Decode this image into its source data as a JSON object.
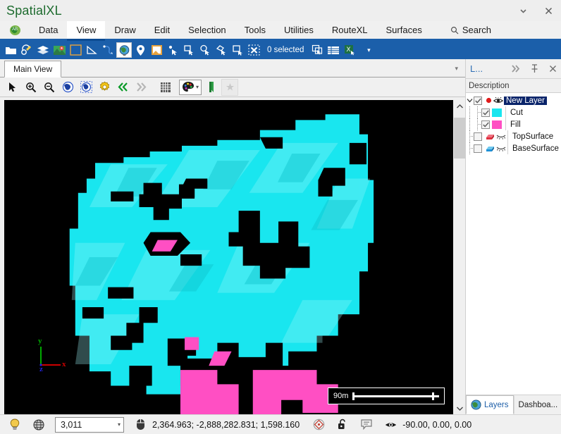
{
  "window": {
    "title": "SpatialXL",
    "minimize_icon": "chevron-down-icon",
    "close_icon": "close-icon"
  },
  "menubar": {
    "logo_icon": "globe-ab-icon",
    "items": [
      {
        "label": "Data",
        "active": false
      },
      {
        "label": "View",
        "active": true
      },
      {
        "label": "Draw",
        "active": false
      },
      {
        "label": "Edit",
        "active": false
      },
      {
        "label": "Selection",
        "active": false
      },
      {
        "label": "Tools",
        "active": false
      },
      {
        "label": "Utilities",
        "active": false
      },
      {
        "label": "RouteXL",
        "active": false
      },
      {
        "label": "Surfaces",
        "active": false
      }
    ],
    "search": {
      "label": "Search",
      "icon": "search-icon"
    }
  },
  "ribbon": {
    "selection_status": "0 selected",
    "buttons": [
      {
        "name": "open-folder-icon"
      },
      {
        "name": "project-settings-icon"
      },
      {
        "name": "layers-stack-icon"
      },
      {
        "name": "map-image-icon"
      },
      {
        "name": "boundary-icon"
      },
      {
        "name": "measure-angle-icon"
      },
      {
        "name": "polyline-tool-icon"
      },
      {
        "name": "globe-icon"
      },
      {
        "name": "place-marker-icon"
      },
      {
        "name": "note-icon"
      },
      {
        "name": "select-point-icon"
      },
      {
        "name": "select-rectangle-icon"
      },
      {
        "name": "select-circle-icon"
      },
      {
        "name": "select-polygon-icon"
      },
      {
        "name": "select-inside-icon"
      },
      {
        "name": "clear-selection-icon"
      },
      {
        "name": "duplicate-selection-icon"
      },
      {
        "name": "attribute-table-icon"
      },
      {
        "name": "export-excel-icon"
      },
      {
        "name": "overflow-caret-icon"
      }
    ]
  },
  "document_tabs": {
    "tabs": [
      {
        "label": "Main View",
        "active": true
      }
    ],
    "overflow_icon": "chevron-down-icon"
  },
  "view_toolbar": {
    "buttons": [
      {
        "name": "pointer-arrow-icon"
      },
      {
        "name": "zoom-in-icon"
      },
      {
        "name": "zoom-out-icon"
      },
      {
        "name": "zoom-extents-globe-icon"
      },
      {
        "name": "zoom-selection-globe-icon"
      },
      {
        "name": "view-settings-gear-icon"
      },
      {
        "name": "previous-view-icon"
      },
      {
        "name": "next-view-icon"
      },
      {
        "name": "grid-icon"
      },
      {
        "name": "color-palette-icon"
      },
      {
        "name": "palette-dropdown-caret-icon"
      },
      {
        "name": "bookmark-flag-icon"
      },
      {
        "name": "favorite-star-icon"
      }
    ]
  },
  "viewport": {
    "scalebar": {
      "label": "90m"
    },
    "axis_gizmo": {
      "x": "x",
      "y": "y",
      "z": "z",
      "x_color": "#cc0000",
      "y_color": "#00aa00",
      "z_color": "#2222dd"
    },
    "background_color": "#000000",
    "cut_color": "#19e6ef",
    "fill_color": "#ff4fc3",
    "scroll": {
      "up_icon": "chevron-up-icon",
      "down_icon": "chevron-down-icon"
    }
  },
  "layers_panel": {
    "title": "L...",
    "header_icons": [
      {
        "name": "expand-right-icon",
        "glyph": "»"
      },
      {
        "name": "pin-icon",
        "glyph": "⚐"
      },
      {
        "name": "close-icon",
        "glyph": "✕"
      }
    ],
    "column_header": "Description",
    "tree": [
      {
        "label": "New Layer",
        "indent": 0,
        "checked": true,
        "selected": true,
        "expander": "collapse-icon",
        "marker_icon": "record-dot-icon",
        "eye_icon": "eye-visible-icon",
        "swatch": null
      },
      {
        "label": "Cut",
        "indent": 1,
        "checked": true,
        "selected": false,
        "expander": null,
        "marker_icon": null,
        "eye_icon": null,
        "swatch": "#19e6ef"
      },
      {
        "label": "Fill",
        "indent": 1,
        "checked": true,
        "selected": false,
        "expander": null,
        "marker_icon": null,
        "eye_icon": null,
        "swatch": "#ff4fc3"
      },
      {
        "label": "TopSurface",
        "indent": 0,
        "checked": false,
        "selected": false,
        "expander": null,
        "marker_icon": "surface-red-icon",
        "eye_icon": "eye-hidden-icon",
        "swatch": null
      },
      {
        "label": "BaseSurface",
        "indent": 0,
        "checked": false,
        "selected": false,
        "expander": null,
        "marker_icon": "surface-blue-icon",
        "eye_icon": "eye-hidden-icon",
        "swatch": null
      }
    ],
    "tabs": [
      {
        "label": "Layers",
        "icon": "globe-icon",
        "active": true
      },
      {
        "label": "Dashboa...",
        "icon": null,
        "active": false
      }
    ]
  },
  "statusbar": {
    "hint_icon": "lightbulb-icon",
    "globe_icon": "wireframe-globe-icon",
    "scale_value": "3,011",
    "scale_caret_icon": "chevron-down-icon",
    "mouse_icon": "mouse-icon",
    "coordinates": "2,364.963; -2,888,282.831; 1,598.160",
    "target_icon": "snap-target-icon",
    "lock_icon": "unlocked-padlock-icon",
    "comment_icon": "annotation-icon",
    "eye_icon": "eye-visible-icon",
    "view_angles": "-90.00, 0.00, 0.00"
  }
}
